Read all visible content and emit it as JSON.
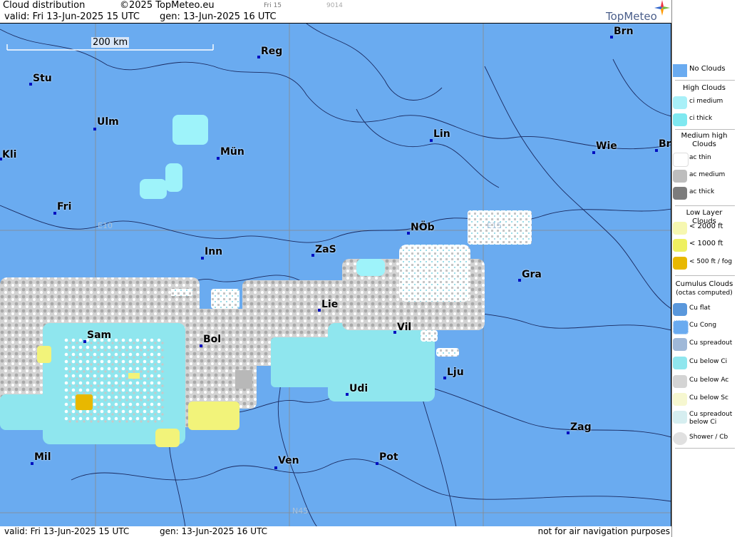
{
  "header": {
    "title": "Cloud distribution",
    "copyright": "©2025 TopMeteo.eu",
    "valid": "valid:  Fri  13-Jun-2025  15 UTC",
    "gen": "gen: 13-Jun-2025 16 UTC",
    "day": "Fri 15",
    "code": "9014",
    "logo": "TopMeteo"
  },
  "scale_bar": "200 km",
  "grid_labels": {
    "e10": "E10",
    "e15": "E15",
    "n45": "N45"
  },
  "cities": {
    "brn": "Brn",
    "reg": "Reg",
    "stu": "Stu",
    "ulm": "Ulm",
    "lin": "Lin",
    "wie": "Wie",
    "bra": "Bra",
    "kli": "Kli",
    "mun": "Mün",
    "fri": "Fri",
    "nob": "NÖb",
    "inn": "Inn",
    "zas": "ZaS",
    "gra": "Gra",
    "lie": "Lie",
    "sam": "Sam",
    "bol": "Bol",
    "vil": "Vil",
    "lju": "Lju",
    "udi": "Udi",
    "zag": "Zag",
    "mil": "Mil",
    "ven": "Ven",
    "pot": "Pot"
  },
  "footer": {
    "valid": "valid:  Fri  13-Jun-2025  15 UTC",
    "gen": "gen: 13-Jun-2025 16 UTC",
    "disclaimer": "not for air navigation purposes"
  },
  "legend": {
    "no_clouds": "No Clouds",
    "high": "High Clouds",
    "ci_medium": "ci medium",
    "ci_thick": "ci thick",
    "medium": "Medium high Clouds",
    "ac_thin": "ac thin",
    "ac_medium": "ac medium",
    "ac_thick": "ac thick",
    "low": "Low Layer Clouds",
    "lt2000": "< 2000 ft",
    "lt1000": "< 1000 ft",
    "lt500": "< 500 ft / fog",
    "cumulus": "Cumulus Clouds",
    "cumulus_sub": "(octas computed)",
    "cu_flat": "Cu flat",
    "cu_cong": "Cu Cong",
    "cu_spreadout": "Cu spreadout",
    "cu_below_ci": "Cu below Ci",
    "cu_below_ac": "Cu below Ac",
    "cu_below_sc": "Cu below Sc",
    "cu_spread_ci_1": "Cu spreadout",
    "cu_spread_ci_2": "below Ci",
    "shower": "Shower / Cb"
  },
  "colors": {
    "no_clouds": "#6aabf0",
    "ci_medium": "#a8f0f8",
    "ci_thick": "#7fe8f0",
    "ac_thin": "#ffffff",
    "ac_medium": "#bdbdbd",
    "ac_thick": "#7c7c7c",
    "low_2000": "#f6f7b0",
    "low_1000": "#eef060",
    "low_500": "#e8b800",
    "cu_flat": "#5a98dc",
    "city_dot": "#0010c0"
  }
}
